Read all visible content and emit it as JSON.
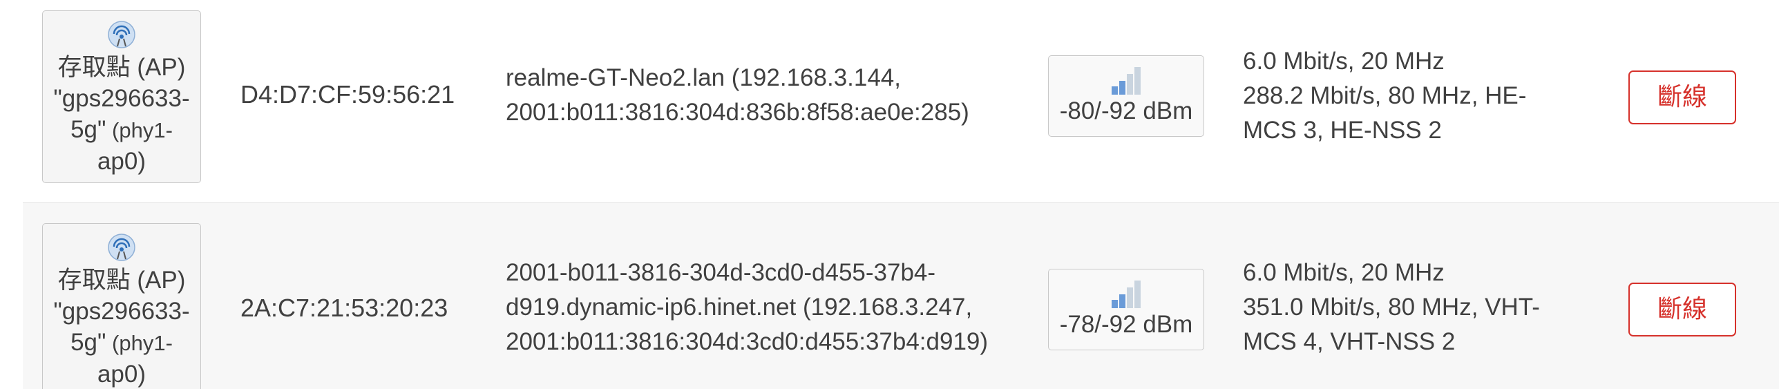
{
  "rows": [
    {
      "interface": {
        "line1": "存取點 (AP)",
        "line2": "\"gps296633-",
        "line3_main": "5g\"",
        "line3_small": " (phy1-",
        "line4": "ap0)"
      },
      "mac": "D4:D7:CF:59:56:21",
      "host_lines": [
        "realme-GT-Neo2.lan (192.168.3.144,",
        "2001:b011:3816:304d:836b:8f58:ae0e:285)"
      ],
      "signal": "-80/-92 dBm",
      "signal_bars_active": 2,
      "rate_lines": [
        "6.0 Mbit/s, 20 MHz",
        "288.2 Mbit/s, 80 MHz, HE-",
        "MCS 3, HE-NSS 2"
      ],
      "disconnect_label": "斷線"
    },
    {
      "interface": {
        "line1": "存取點 (AP)",
        "line2": "\"gps296633-",
        "line3_main": "5g\"",
        "line3_small": " (phy1-",
        "line4": "ap0)"
      },
      "mac": "2A:C7:21:53:20:23",
      "host_lines": [
        "2001-b011-3816-304d-3cd0-d455-37b4-",
        "d919.dynamic-ip6.hinet.net (192.168.3.247,",
        "2001:b011:3816:304d:3cd0:d455:37b4:d919)"
      ],
      "signal": "-78/-92 dBm",
      "signal_bars_active": 2,
      "rate_lines": [
        "6.0 Mbit/s, 20 MHz",
        "351.0 Mbit/s, 80 MHz, VHT-",
        "MCS 4, VHT-NSS 2"
      ],
      "disconnect_label": "斷線"
    }
  ],
  "colors": {
    "danger": "#d6312b",
    "signal_active": "#6a9bd8",
    "signal_inactive": "#c9d4df"
  },
  "icons": {
    "interface": "wifi-ap-icon",
    "signal": "signal-strength-icon"
  }
}
